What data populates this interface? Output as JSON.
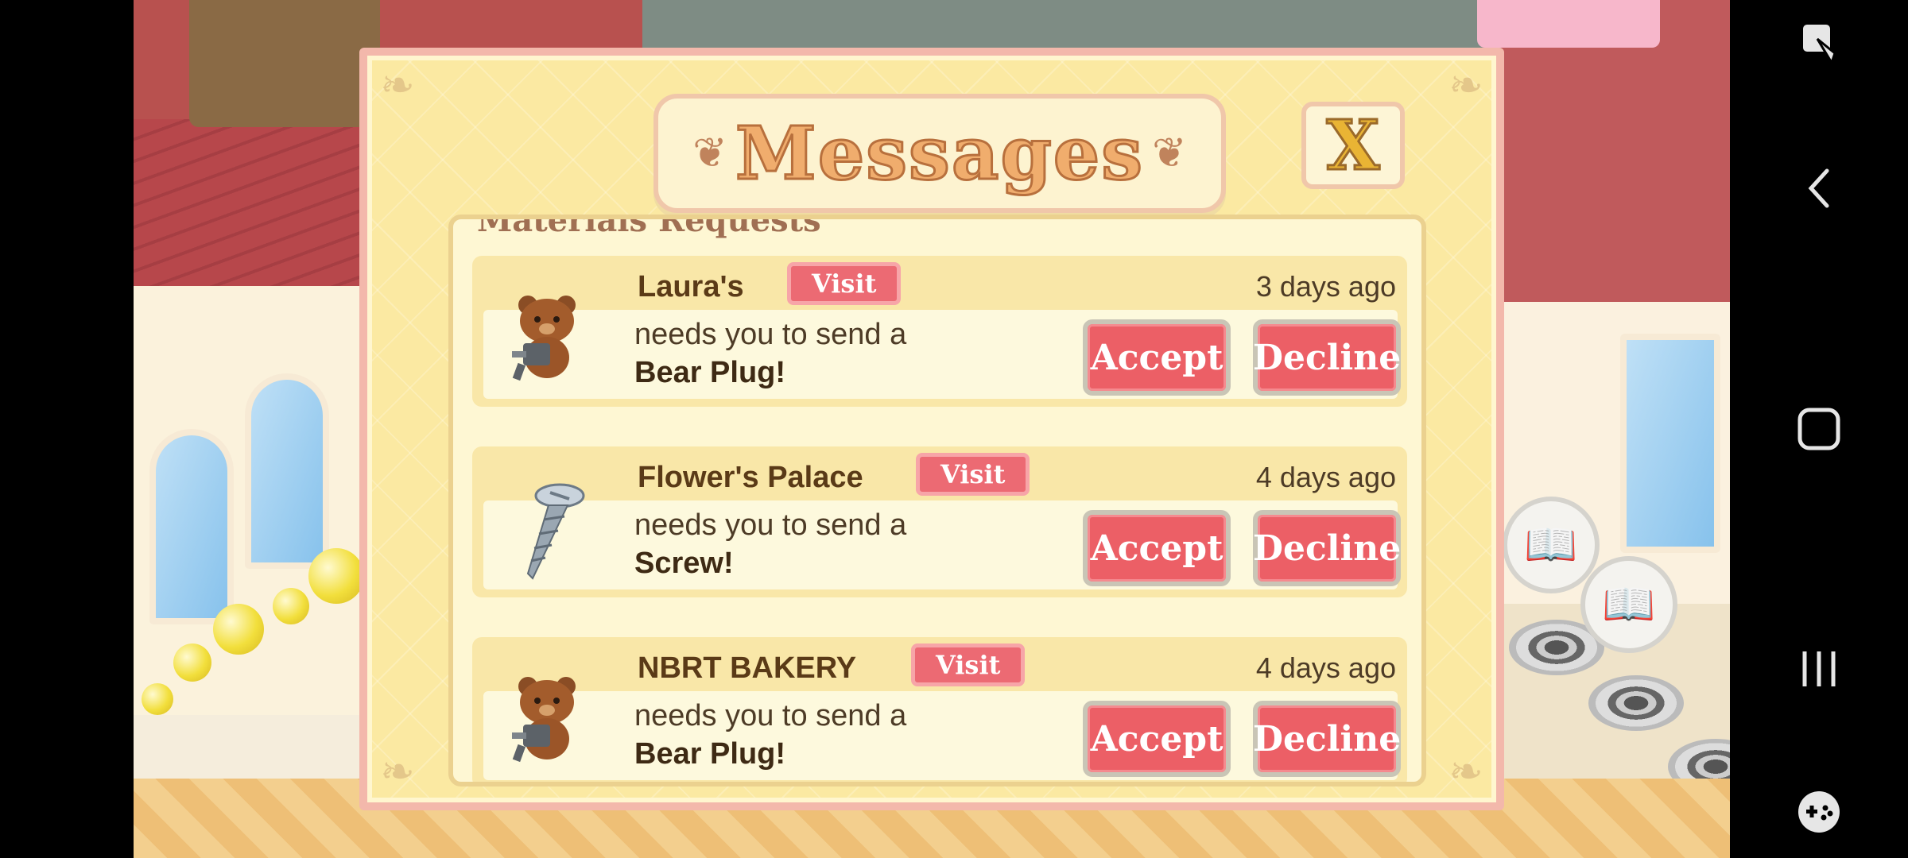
{
  "dialog": {
    "title": "Messages",
    "close_label": "X",
    "section_heading": "Materials Requests"
  },
  "messages": [
    {
      "name": "Laura's",
      "visit_label": "Visit",
      "time": "3 days ago",
      "line1": "needs you to send a",
      "item": "Bear Plug!",
      "icon": "bear-plug-icon",
      "accept_label": "Accept",
      "decline_label": "Decline"
    },
    {
      "name": "Flower's Palace",
      "visit_label": "Visit",
      "time": "4 days ago",
      "line1": "needs you to send a",
      "item": "Screw!",
      "icon": "screw-icon",
      "accept_label": "Accept",
      "decline_label": "Decline"
    },
    {
      "name": "NBRT BAKERY",
      "visit_label": "Visit",
      "time": "4 days ago",
      "line1": "needs you to send a",
      "item": "Bear Plug!",
      "icon": "bear-plug-icon",
      "accept_label": "Accept",
      "decline_label": "Decline"
    }
  ],
  "navbar": {
    "icons": [
      "screen-lock-icon",
      "back-icon",
      "home-icon",
      "recent-apps-icon",
      "game-controller-icon"
    ]
  },
  "colors": {
    "button_red": "#ec5f66",
    "dialog_bg": "#fbe9a2",
    "dialog_border": "#f3b8ab",
    "text_brown": "#5a3a17"
  }
}
